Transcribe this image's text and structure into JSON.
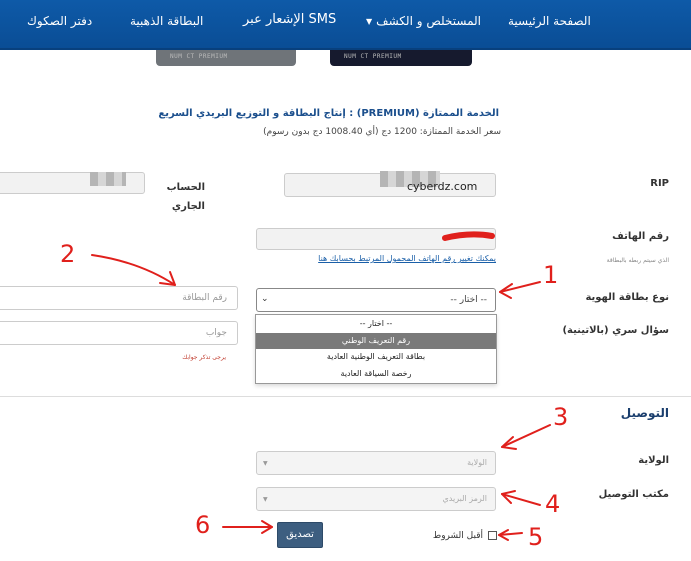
{
  "nav": {
    "items": [
      "الصفحة الرئيسية",
      "المستخلص و الكشف",
      "الإشعار عبر SMS",
      "البطاقة الذهبية",
      "دفتر الصكوك"
    ],
    "card_text": "NUM CT PREMIUM"
  },
  "premium": {
    "title": "الخدمة الممتازة (PREMIUM) : إنتاج البطاقة و التوزيع البريدي السريع",
    "price": "سعر الخدمة الممتازة: 1200 دج (أي 1008.40 دج بدون رسوم)"
  },
  "form": {
    "rip_label": "RIP",
    "account_label": "الحساب الجاري",
    "watermark": "cyberdz.com",
    "phone_label": "رقم الهاتف",
    "phone_hint": "الذي سيتم ربطه بالبطاقة",
    "phone_link": "يمكنك تغيير رقم الهاتف المحمول المرتبط بحسابك هنا",
    "id_type_label": "نوع بطاقة الهوية",
    "id_type_selected": "-- اختار --",
    "card_number_placeholder": "رقم البطاقة",
    "secret_label": "سؤال سري (بالاتينية)",
    "answer_placeholder": "جواب",
    "answer_error": "يرجى تذكر جوابك",
    "dropdown_options": [
      "-- اختار --",
      "رقم التعريف الوطني",
      "بطاقة التعريف الوطنية العادية",
      "رخصة السياقة العادية"
    ]
  },
  "delivery": {
    "heading": "التوصيل",
    "wilaya_label": "الولاية",
    "wilaya_placeholder": "الولاية",
    "office_label": "مكتب التوصيل",
    "office_placeholder": "الرمز البريدي",
    "terms_label": "أقبل الشروط",
    "submit_label": "تصديق"
  },
  "annotations": {
    "numbers": [
      "1",
      "2",
      "3",
      "4",
      "5",
      "6"
    ],
    "color": "#e0201c"
  },
  "colors": {
    "nav_bg": "#0e5aa8",
    "title_blue": "#1b4f8d",
    "button_bg": "#3d5e80",
    "link_blue": "#1a5fa8"
  }
}
